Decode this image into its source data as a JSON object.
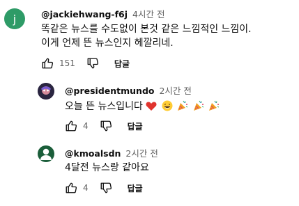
{
  "comments": [
    {
      "author": "@jackiehwang-f6j",
      "time": "4시간 전",
      "avatar_letter": "j",
      "avatar_color": "#2e9b67",
      "lines": [
        "똑같은 뉴스를 수도없이 본것 같은 느낌적인 느낌이.",
        "이게 언제 뜬 뉴스인지 헤깔리네."
      ],
      "likes": "151",
      "reply_label": "답글"
    },
    {
      "author": "@presidentmundo",
      "time": "2시간 전",
      "text": "오늘 뜬 뉴스입니다",
      "emojis": [
        "red-heart-icon",
        "grinning-face-icon",
        "party-popper-icon",
        "party-popper-icon",
        "party-popper-icon"
      ],
      "likes": "4",
      "reply_label": "답글"
    },
    {
      "author": "@kmoalsdn",
      "time": "2시간 전",
      "text": "4달전 뉴스랑 같아요",
      "avatar_color": "#1b5e3a",
      "likes": "4",
      "reply_label": "답글"
    }
  ],
  "colors": {
    "secondary_text": "#606060",
    "primary_text": "#0f0f0f"
  }
}
